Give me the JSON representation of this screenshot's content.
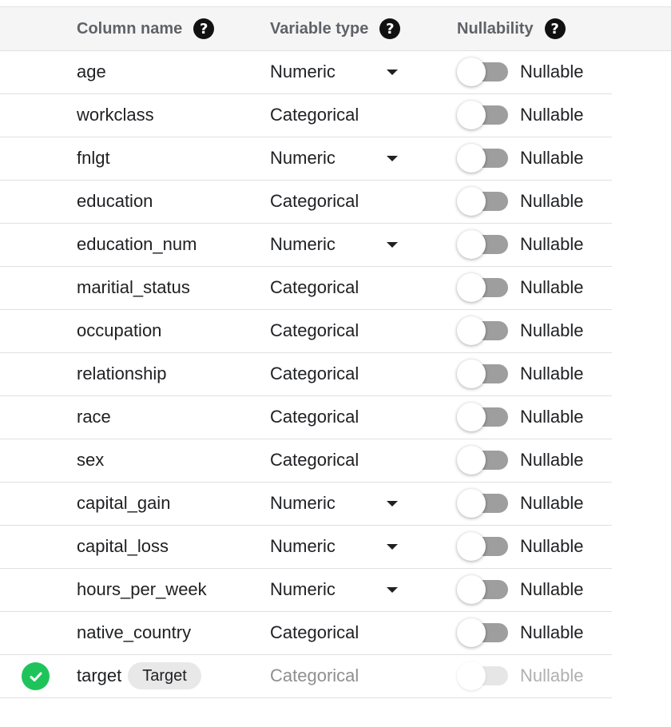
{
  "header": {
    "column_name": "Column name",
    "variable_type": "Variable type",
    "nullability": "Nullability",
    "help_glyph": "?"
  },
  "colors": {
    "target_check": "#1ec45a",
    "toggle_track": "#9e9e9e",
    "toggle_track_disabled": "#e6e6e6"
  },
  "rows": [
    {
      "name": "age",
      "type": "Numeric",
      "has_dropdown": true,
      "nullable_label": "Nullable",
      "nullable_on": false
    },
    {
      "name": "workclass",
      "type": "Categorical",
      "has_dropdown": false,
      "nullable_label": "Nullable",
      "nullable_on": false
    },
    {
      "name": "fnlgt",
      "type": "Numeric",
      "has_dropdown": true,
      "nullable_label": "Nullable",
      "nullable_on": false
    },
    {
      "name": "education",
      "type": "Categorical",
      "has_dropdown": false,
      "nullable_label": "Nullable",
      "nullable_on": false
    },
    {
      "name": "education_num",
      "type": "Numeric",
      "has_dropdown": true,
      "nullable_label": "Nullable",
      "nullable_on": false
    },
    {
      "name": "maritial_status",
      "type": "Categorical",
      "has_dropdown": false,
      "nullable_label": "Nullable",
      "nullable_on": false
    },
    {
      "name": "occupation",
      "type": "Categorical",
      "has_dropdown": false,
      "nullable_label": "Nullable",
      "nullable_on": false
    },
    {
      "name": "relationship",
      "type": "Categorical",
      "has_dropdown": false,
      "nullable_label": "Nullable",
      "nullable_on": false
    },
    {
      "name": "race",
      "type": "Categorical",
      "has_dropdown": false,
      "nullable_label": "Nullable",
      "nullable_on": false
    },
    {
      "name": "sex",
      "type": "Categorical",
      "has_dropdown": false,
      "nullable_label": "Nullable",
      "nullable_on": false
    },
    {
      "name": "capital_gain",
      "type": "Numeric",
      "has_dropdown": true,
      "nullable_label": "Nullable",
      "nullable_on": false
    },
    {
      "name": "capital_loss",
      "type": "Numeric",
      "has_dropdown": true,
      "nullable_label": "Nullable",
      "nullable_on": false
    },
    {
      "name": "hours_per_week",
      "type": "Numeric",
      "has_dropdown": true,
      "nullable_label": "Nullable",
      "nullable_on": false
    },
    {
      "name": "native_country",
      "type": "Categorical",
      "has_dropdown": false,
      "nullable_label": "Nullable",
      "nullable_on": false
    },
    {
      "name": "target",
      "type": "Categorical",
      "has_dropdown": false,
      "nullable_label": "Nullable",
      "nullable_on": false,
      "is_target": true,
      "chip": "Target",
      "disabled": true
    }
  ]
}
